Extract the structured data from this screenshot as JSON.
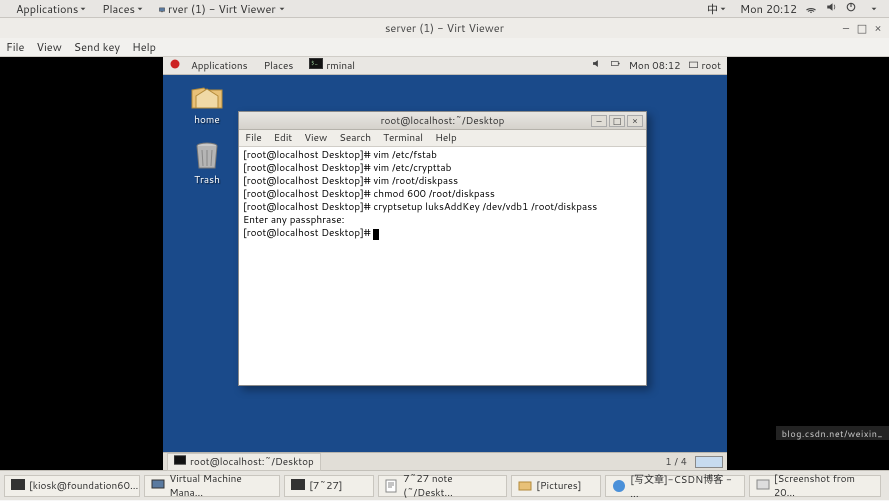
{
  "outer": {
    "applications": "Applications",
    "places": "Places",
    "active_window": "rver (1) - Virt Viewer",
    "input_method": "中",
    "clock": "Mon 20:12"
  },
  "viewer": {
    "title": "server (1) - Virt Viewer",
    "menu": {
      "file": "File",
      "view": "View",
      "sendkey": "Send key",
      "help": "Help"
    }
  },
  "vm": {
    "applications": "Applications",
    "places": "Places",
    "active_task": "rminal",
    "clock": "Mon 08:12",
    "user": "root",
    "desktop_icons": {
      "home": "home",
      "trash": "Trash"
    },
    "taskbar_active": "root@localhost:~/Desktop",
    "pager": "1 / 4"
  },
  "terminal": {
    "title": "root@localhost:~/Desktop",
    "menu": {
      "file": "File",
      "edit": "Edit",
      "view": "View",
      "search": "Search",
      "terminal": "Terminal",
      "help": "Help"
    },
    "lines": [
      "[root@localhost Desktop]# vim /etc/fstab",
      "[root@localhost Desktop]# vim /etc/crypttab",
      "[root@localhost Desktop]# vim /root/diskpass",
      "[root@localhost Desktop]# chmod 600 /root/diskpass",
      "[root@localhost Desktop]# cryptsetup luksAddKey /dev/vdb1 /root/diskpass",
      "Enter any passphrase:",
      "[root@localhost Desktop]# "
    ]
  },
  "bottom": {
    "tasks": [
      "[kiosk@foundation60...",
      "Virtual Machine Mana...",
      "[7~27]",
      "7~27 note (~/Deskt...",
      "[Pictures]",
      "[写文章]-CSDN博客 - ...",
      "[Screenshot from 20..."
    ],
    "watermark": "blog.csdn.net/weixin_"
  }
}
